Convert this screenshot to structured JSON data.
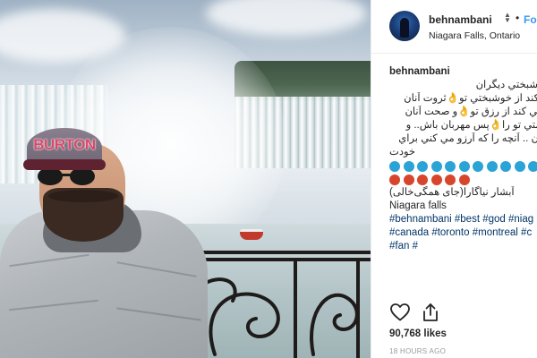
{
  "post": {
    "username": "behnambani",
    "follow_label": "Follow",
    "location": "Niagara Falls, Ontario",
    "photo_alt": "Man in BURTON cap and sunglasses standing at Niagara Falls",
    "cap_text": "BURTON",
    "caption": {
      "username": "behnambani",
      "lines": [
        "، خوشبختي ديگران",
        "مي كند از خوشبختي تو👌ثروت آنان",
        "م نمي كند از رزق تو👌و صحت آنان",
        "سلامتي تو را👌پس مهربان باش.. و",
        "يگران .. آنچه را كه آرزو مي كني براي",
        "خودت"
      ],
      "blue_count": 12,
      "red_count": 6,
      "persian_tag": "آبشار نیاگارا(جای همگی‌خالی)",
      "english_tag": "Niagara falls",
      "hashtag_lines": [
        "#behnambani #best #god #niag",
        "#canada #toronto #montreal #c",
        "#fan #"
      ]
    },
    "likes": "90,768 likes",
    "timestamp": "18 HOURS AGO"
  },
  "colors": {
    "follow_blue": "#3897f0",
    "emoji_blue": "#2aa3d6",
    "emoji_red": "#d7452c",
    "hashtag": "#003569",
    "text": "#262626",
    "muted": "#999999"
  },
  "icons": {
    "heart": "heart-outline-icon",
    "share": "share-icon",
    "verified": "updown-icon"
  }
}
